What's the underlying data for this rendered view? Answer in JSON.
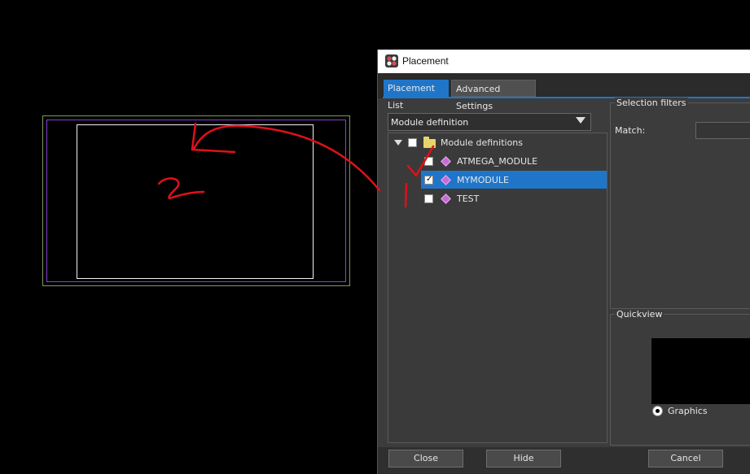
{
  "dialog": {
    "title": "Placement",
    "tabs": [
      {
        "label": "Placement List",
        "active": true
      },
      {
        "label": "Advanced Settings",
        "active": false
      }
    ]
  },
  "placement_list": {
    "type_select": {
      "selected": "Module definition"
    },
    "tree": {
      "root": {
        "label": "Module definitions",
        "expanded": true,
        "checked": false
      },
      "items": [
        {
          "label": "ATMEGA_MODULE",
          "checked": false
        },
        {
          "label": "MYMODULE",
          "checked": true,
          "selected": true
        },
        {
          "label": "TEST",
          "checked": false
        }
      ]
    }
  },
  "selection_filters": {
    "title": "Selection filters",
    "match_label": "Match:",
    "match_value": ""
  },
  "quickview": {
    "title": "Quickview",
    "radio_label": "Graphics"
  },
  "buttons": {
    "close": "Close",
    "hide": "Hide",
    "cancel": "Cancel"
  },
  "annotations": {
    "label_1": "1",
    "label_2": "2",
    "color": "#e0101a"
  },
  "colors": {
    "board_outline": "#7c9a58",
    "board_keepout": "#8a3fd6",
    "board_module": "#f2f2f2",
    "accent": "#1f76c9"
  }
}
